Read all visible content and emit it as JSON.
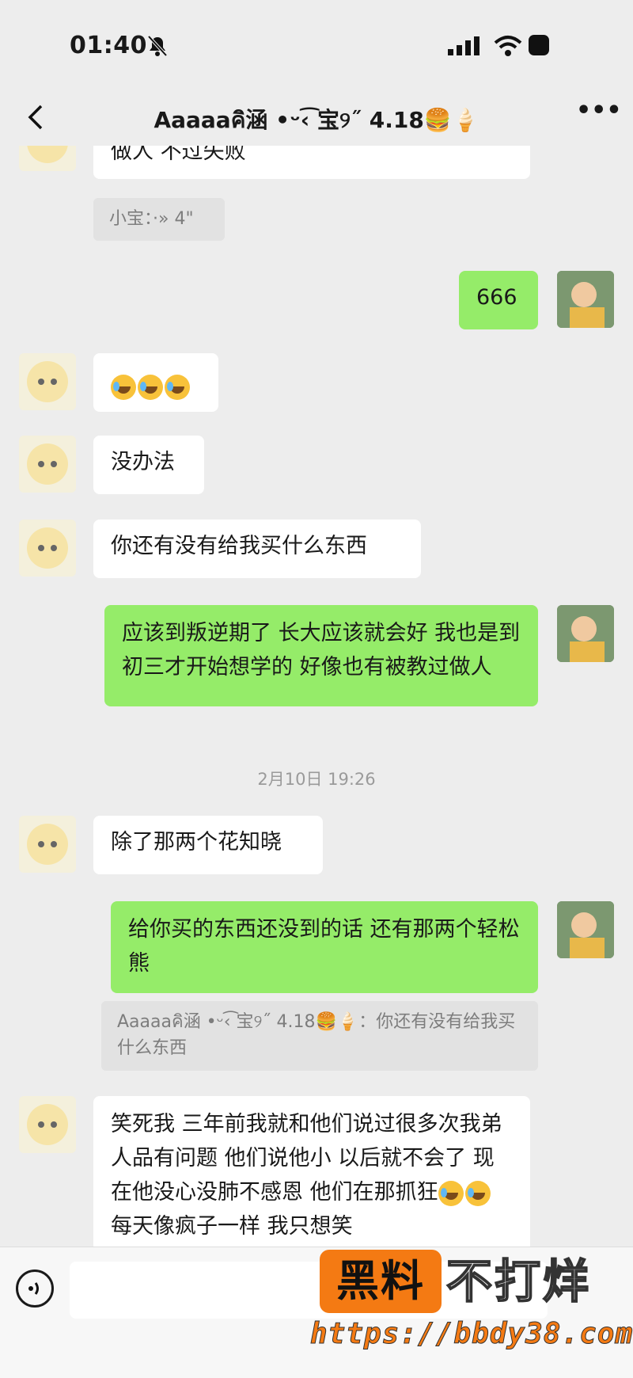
{
  "status": {
    "time": "01:40"
  },
  "nav": {
    "title": "Aaaaaคิ涵 •ᵕ‹͡ 宝୨˝ 4.18🍔🍦",
    "more": "•••"
  },
  "messages": {
    "m1": "做人 不过失败",
    "q1": "小宝：·» 4\"",
    "m2": "666",
    "m4": "没办法",
    "m5": "你还有没有给我买什么东西",
    "m6": "应该到叛逆期了 长大应该就会好 我也是到初三才开始想学的 好像也有被教过做人",
    "ts": "2月10日 19:26",
    "m7": "除了那两个花知晓",
    "m8": "给你买的东西还没到的话 还有那两个轻松熊",
    "q2": "Aaaaaคิ涵 •ᵕ‹͡ 宝୨˝ 4.18🍔🍦：你还有没有给我买什么东西",
    "m9a": "笑死我 三年前我就和他们说过很多次我弟人品有问题 他们说他小 以后就不会了 现在他没心没肺不感恩 他们在那抓狂",
    "m9b": "每天像疯子一样 我只想笑"
  },
  "watermark": {
    "tag": "黑料",
    "text": "不打烊",
    "url": "https://bbdy38.com"
  },
  "icons": {
    "back": "chevron-left-icon",
    "bell": "bell-off-icon",
    "signal": "signal-icon",
    "wifi": "wifi-icon",
    "battery": "battery-icon",
    "voice": "voice-icon",
    "emoji": "laugh-cry-emoji"
  },
  "colors": {
    "background": "#ededed",
    "bubble_self": "#95ec69",
    "bubble_other": "#ffffff",
    "watermark": "#f47a13"
  }
}
